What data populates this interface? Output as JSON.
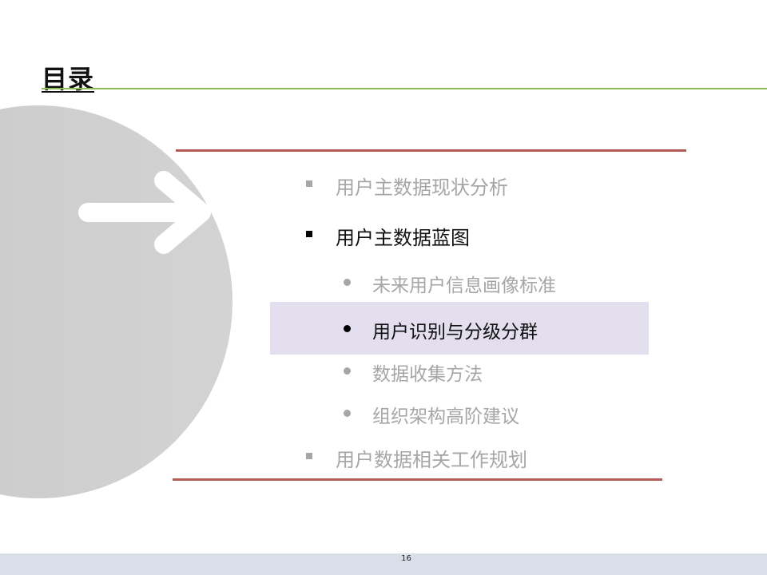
{
  "slide": {
    "title": "目录",
    "page_number": "16"
  },
  "toc": {
    "items": [
      {
        "label": "用户主数据现状分析",
        "level": 1,
        "state": "muted"
      },
      {
        "label": "用户主数据蓝图",
        "level": 1,
        "state": "active"
      },
      {
        "label": "未来用户信息画像标准",
        "level": 2,
        "state": "muted"
      },
      {
        "label": "用户识别与分级分群",
        "level": 2,
        "state": "active-highlight"
      },
      {
        "label": "数据收集方法",
        "level": 2,
        "state": "muted"
      },
      {
        "label": "组织架构高阶建议",
        "level": 2,
        "state": "muted"
      },
      {
        "label": "用户数据相关工作规划",
        "level": 1,
        "state": "muted"
      }
    ]
  },
  "colors": {
    "title_rule": "#8bbd52",
    "section_rule": "#b45a57",
    "highlight": "#e4dfee",
    "circle": "#cccccc",
    "footer": "#d9dfe8"
  },
  "icons": {
    "decor": "arrow-right-icon"
  }
}
